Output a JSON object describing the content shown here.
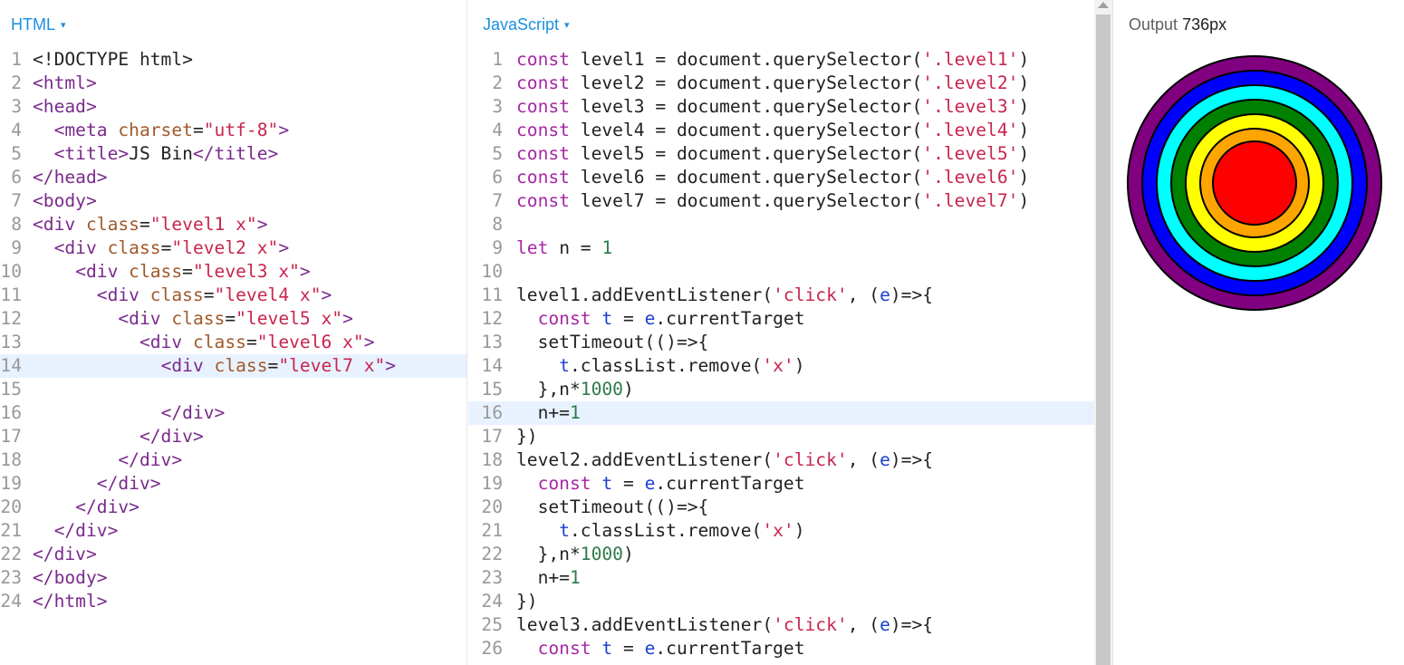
{
  "html_panel": {
    "title": "HTML",
    "caret": "▾",
    "lines": [
      {
        "n": "1",
        "parts": [
          [
            "t-def",
            "<!DOCTYPE html>"
          ]
        ]
      },
      {
        "n": "2",
        "parts": [
          [
            "t-tag",
            "<html>"
          ]
        ]
      },
      {
        "n": "3",
        "parts": [
          [
            "t-tag",
            "<head>"
          ]
        ]
      },
      {
        "n": "4",
        "parts": [
          [
            "t-def",
            "  "
          ],
          [
            "t-tag",
            "<meta "
          ],
          [
            "t-attr",
            "charset"
          ],
          [
            "t-def",
            "="
          ],
          [
            "t-str",
            "\"utf-8\""
          ],
          [
            "t-tag",
            ">"
          ]
        ]
      },
      {
        "n": "5",
        "parts": [
          [
            "t-def",
            "  "
          ],
          [
            "t-tag",
            "<title>"
          ],
          [
            "t-def",
            "JS Bin"
          ],
          [
            "t-tag",
            "</title>"
          ]
        ]
      },
      {
        "n": "6",
        "parts": [
          [
            "t-tag",
            "</head>"
          ]
        ]
      },
      {
        "n": "7",
        "parts": [
          [
            "t-tag",
            "<body>"
          ]
        ]
      },
      {
        "n": "8",
        "parts": [
          [
            "t-tag",
            "<div "
          ],
          [
            "t-attr",
            "class"
          ],
          [
            "t-def",
            "="
          ],
          [
            "t-str",
            "\"level1 x\""
          ],
          [
            "t-tag",
            ">"
          ]
        ]
      },
      {
        "n": "9",
        "parts": [
          [
            "t-def",
            "  "
          ],
          [
            "t-tag",
            "<div "
          ],
          [
            "t-attr",
            "class"
          ],
          [
            "t-def",
            "="
          ],
          [
            "t-str",
            "\"level2 x\""
          ],
          [
            "t-tag",
            ">"
          ]
        ]
      },
      {
        "n": "10",
        "parts": [
          [
            "t-def",
            "    "
          ],
          [
            "t-tag",
            "<div "
          ],
          [
            "t-attr",
            "class"
          ],
          [
            "t-def",
            "="
          ],
          [
            "t-str",
            "\"level3 x\""
          ],
          [
            "t-tag",
            ">"
          ]
        ]
      },
      {
        "n": "11",
        "parts": [
          [
            "t-def",
            "      "
          ],
          [
            "t-tag",
            "<div "
          ],
          [
            "t-attr",
            "class"
          ],
          [
            "t-def",
            "="
          ],
          [
            "t-str",
            "\"level4 x\""
          ],
          [
            "t-tag",
            ">"
          ]
        ]
      },
      {
        "n": "12",
        "parts": [
          [
            "t-def",
            "        "
          ],
          [
            "t-tag",
            "<div "
          ],
          [
            "t-attr",
            "class"
          ],
          [
            "t-def",
            "="
          ],
          [
            "t-str",
            "\"level5 x\""
          ],
          [
            "t-tag",
            ">"
          ]
        ]
      },
      {
        "n": "13",
        "parts": [
          [
            "t-def",
            "          "
          ],
          [
            "t-tag",
            "<div "
          ],
          [
            "t-attr",
            "class"
          ],
          [
            "t-def",
            "="
          ],
          [
            "t-str",
            "\"level6 x\""
          ],
          [
            "t-tag",
            ">"
          ]
        ]
      },
      {
        "n": "14",
        "active": true,
        "parts": [
          [
            "t-def",
            "            "
          ],
          [
            "t-tag",
            "<div "
          ],
          [
            "t-attr",
            "class"
          ],
          [
            "t-def",
            "="
          ],
          [
            "t-str",
            "\"level7 x\""
          ],
          [
            "t-tag",
            ">"
          ]
        ]
      },
      {
        "n": "15",
        "parts": []
      },
      {
        "n": "16",
        "parts": [
          [
            "t-def",
            "            "
          ],
          [
            "t-tag",
            "</div>"
          ]
        ]
      },
      {
        "n": "17",
        "parts": [
          [
            "t-def",
            "          "
          ],
          [
            "t-tag",
            "</div>"
          ]
        ]
      },
      {
        "n": "18",
        "parts": [
          [
            "t-def",
            "        "
          ],
          [
            "t-tag",
            "</div>"
          ]
        ]
      },
      {
        "n": "19",
        "parts": [
          [
            "t-def",
            "      "
          ],
          [
            "t-tag",
            "</div>"
          ]
        ]
      },
      {
        "n": "20",
        "parts": [
          [
            "t-def",
            "    "
          ],
          [
            "t-tag",
            "</div>"
          ]
        ]
      },
      {
        "n": "21",
        "parts": [
          [
            "t-def",
            "  "
          ],
          [
            "t-tag",
            "</div>"
          ]
        ]
      },
      {
        "n": "22",
        "parts": [
          [
            "t-tag",
            "</div>"
          ]
        ]
      },
      {
        "n": "23",
        "parts": [
          [
            "t-tag",
            "</body>"
          ]
        ]
      },
      {
        "n": "24",
        "parts": [
          [
            "t-tag",
            "</html>"
          ]
        ]
      }
    ]
  },
  "js_panel": {
    "title": "JavaScript",
    "caret": "▾",
    "lines": [
      {
        "n": "1",
        "parts": [
          [
            "t-kw",
            "const "
          ],
          [
            "t-def",
            "level1 = document.querySelector("
          ],
          [
            "t-str",
            "'.level1'"
          ],
          [
            "t-def",
            ")"
          ]
        ]
      },
      {
        "n": "2",
        "parts": [
          [
            "t-kw",
            "const "
          ],
          [
            "t-def",
            "level2 = document.querySelector("
          ],
          [
            "t-str",
            "'.level2'"
          ],
          [
            "t-def",
            ")"
          ]
        ]
      },
      {
        "n": "3",
        "parts": [
          [
            "t-kw",
            "const "
          ],
          [
            "t-def",
            "level3 = document.querySelector("
          ],
          [
            "t-str",
            "'.level3'"
          ],
          [
            "t-def",
            ")"
          ]
        ]
      },
      {
        "n": "4",
        "parts": [
          [
            "t-kw",
            "const "
          ],
          [
            "t-def",
            "level4 = document.querySelector("
          ],
          [
            "t-str",
            "'.level4'"
          ],
          [
            "t-def",
            ")"
          ]
        ]
      },
      {
        "n": "5",
        "parts": [
          [
            "t-kw",
            "const "
          ],
          [
            "t-def",
            "level5 = document.querySelector("
          ],
          [
            "t-str",
            "'.level5'"
          ],
          [
            "t-def",
            ")"
          ]
        ]
      },
      {
        "n": "6",
        "parts": [
          [
            "t-kw",
            "const "
          ],
          [
            "t-def",
            "level6 = document.querySelector("
          ],
          [
            "t-str",
            "'.level6'"
          ],
          [
            "t-def",
            ")"
          ]
        ]
      },
      {
        "n": "7",
        "parts": [
          [
            "t-kw",
            "const "
          ],
          [
            "t-def",
            "level7 = document.querySelector("
          ],
          [
            "t-str",
            "'.level7'"
          ],
          [
            "t-def",
            ")"
          ]
        ]
      },
      {
        "n": "8",
        "parts": []
      },
      {
        "n": "9",
        "parts": [
          [
            "t-kw",
            "let "
          ],
          [
            "t-def",
            "n = "
          ],
          [
            "t-num",
            "1"
          ]
        ]
      },
      {
        "n": "10",
        "parts": []
      },
      {
        "n": "11",
        "parts": [
          [
            "t-def",
            "level1.addEventListener("
          ],
          [
            "t-str",
            "'click'"
          ],
          [
            "t-def",
            ", ("
          ],
          [
            "t-var",
            "e"
          ],
          [
            "t-def",
            ")=>{"
          ]
        ]
      },
      {
        "n": "12",
        "parts": [
          [
            "t-def",
            "  "
          ],
          [
            "t-kw",
            "const "
          ],
          [
            "t-var",
            "t"
          ],
          [
            "t-def",
            " = "
          ],
          [
            "t-var",
            "e"
          ],
          [
            "t-def",
            ".currentTarget"
          ]
        ]
      },
      {
        "n": "13",
        "parts": [
          [
            "t-def",
            "  setTimeout(()=>{"
          ]
        ]
      },
      {
        "n": "14",
        "parts": [
          [
            "t-def",
            "    "
          ],
          [
            "t-var",
            "t"
          ],
          [
            "t-def",
            ".classList.remove("
          ],
          [
            "t-str",
            "'x'"
          ],
          [
            "t-def",
            ")"
          ]
        ]
      },
      {
        "n": "15",
        "parts": [
          [
            "t-def",
            "  },n*"
          ],
          [
            "t-num",
            "1000"
          ],
          [
            "t-def",
            ")"
          ]
        ]
      },
      {
        "n": "16",
        "active": true,
        "parts": [
          [
            "t-def",
            "  n+="
          ],
          [
            "t-num",
            "1"
          ]
        ]
      },
      {
        "n": "17",
        "parts": [
          [
            "t-def",
            "})"
          ]
        ]
      },
      {
        "n": "18",
        "parts": [
          [
            "t-def",
            "level2.addEventListener("
          ],
          [
            "t-str",
            "'click'"
          ],
          [
            "t-def",
            ", ("
          ],
          [
            "t-var",
            "e"
          ],
          [
            "t-def",
            ")=>{"
          ]
        ]
      },
      {
        "n": "19",
        "parts": [
          [
            "t-def",
            "  "
          ],
          [
            "t-kw",
            "const "
          ],
          [
            "t-var",
            "t"
          ],
          [
            "t-def",
            " = "
          ],
          [
            "t-var",
            "e"
          ],
          [
            "t-def",
            ".currentTarget"
          ]
        ]
      },
      {
        "n": "20",
        "parts": [
          [
            "t-def",
            "  setTimeout(()=>{"
          ]
        ]
      },
      {
        "n": "21",
        "parts": [
          [
            "t-def",
            "    "
          ],
          [
            "t-var",
            "t"
          ],
          [
            "t-def",
            ".classList.remove("
          ],
          [
            "t-str",
            "'x'"
          ],
          [
            "t-def",
            ")"
          ]
        ]
      },
      {
        "n": "22",
        "parts": [
          [
            "t-def",
            "  },n*"
          ],
          [
            "t-num",
            "1000"
          ],
          [
            "t-def",
            ")"
          ]
        ]
      },
      {
        "n": "23",
        "parts": [
          [
            "t-def",
            "  n+="
          ],
          [
            "t-num",
            "1"
          ]
        ]
      },
      {
        "n": "24",
        "parts": [
          [
            "t-def",
            "})"
          ]
        ]
      },
      {
        "n": "25",
        "parts": [
          [
            "t-def",
            "level3.addEventListener("
          ],
          [
            "t-str",
            "'click'"
          ],
          [
            "t-def",
            ", ("
          ],
          [
            "t-var",
            "e"
          ],
          [
            "t-def",
            ")=>{"
          ]
        ]
      },
      {
        "n": "26",
        "parts": [
          [
            "t-def",
            "  "
          ],
          [
            "t-kw",
            "const "
          ],
          [
            "t-var",
            "t"
          ],
          [
            "t-def",
            " = "
          ],
          [
            "t-var",
            "e"
          ],
          [
            "t-def",
            ".currentTarget"
          ]
        ]
      }
    ]
  },
  "output_panel": {
    "label": "Output",
    "width_text": "736px",
    "rings": [
      {
        "name": "level1",
        "color": "#800080"
      },
      {
        "name": "level2",
        "color": "#0000ff"
      },
      {
        "name": "level3",
        "color": "#00ffff"
      },
      {
        "name": "level4",
        "color": "#008000"
      },
      {
        "name": "level5",
        "color": "#ffff00"
      },
      {
        "name": "level6",
        "color": "#ffa500"
      },
      {
        "name": "level7",
        "color": "#ff0000"
      }
    ]
  }
}
